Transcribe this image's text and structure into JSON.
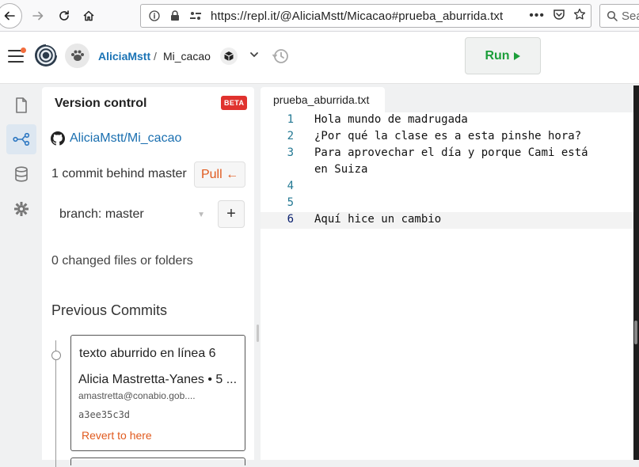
{
  "browser": {
    "url": "https://repl.it/@AliciaMstt/Micacao#prueba_aburrida.txt",
    "search_placeholder": "Sea"
  },
  "header": {
    "username": "AliciaMstt",
    "separator": "/",
    "repl_name": "Mi_cacao",
    "run_label": "Run",
    "run_color": "#1c9e3a"
  },
  "sidebar": {
    "items": [
      {
        "name": "files",
        "icon": "file-icon"
      },
      {
        "name": "version-control",
        "icon": "git-branch-icon",
        "active": true
      },
      {
        "name": "database",
        "icon": "database-icon"
      },
      {
        "name": "settings",
        "icon": "gear-icon"
      }
    ]
  },
  "vc": {
    "title": "Version control",
    "beta_label": "BETA",
    "repo_link": "AliciaMstt/Mi_cacao",
    "behind_text": "1 commit behind master",
    "pull_label": "Pull ←",
    "branch_label": "branch: master",
    "add_branch_label": "+",
    "changed_text": "0 changed files or folders",
    "previous_title": "Previous Commits",
    "commits": [
      {
        "message": "texto aburrido en línea 6",
        "author": "Alicia Mastretta-Yanes • 5 ...",
        "email": "amastretta@conabio.gob....",
        "hash": "a3ee35c3d",
        "revert_label": "Revert to here"
      }
    ]
  },
  "editor": {
    "tab_name": "prueba_aburrida.txt",
    "lines": [
      {
        "num": "1",
        "text": "Hola mundo de madrugada"
      },
      {
        "num": "2",
        "text": "¿Por qué la clase es a esta pinshe hora?"
      },
      {
        "num": "3",
        "text": "Para aprovechar el día y porque Cami está"
      },
      {
        "num": "",
        "text": "en Suiza"
      },
      {
        "num": "4",
        "text": ""
      },
      {
        "num": "5",
        "text": ""
      },
      {
        "num": "6",
        "text": "Aquí hice un cambio"
      }
    ],
    "current_line": "6"
  },
  "colors": {
    "link_blue": "#1a73b5",
    "accent_orange": "#e05a1e",
    "beta_red": "#e0322e"
  }
}
